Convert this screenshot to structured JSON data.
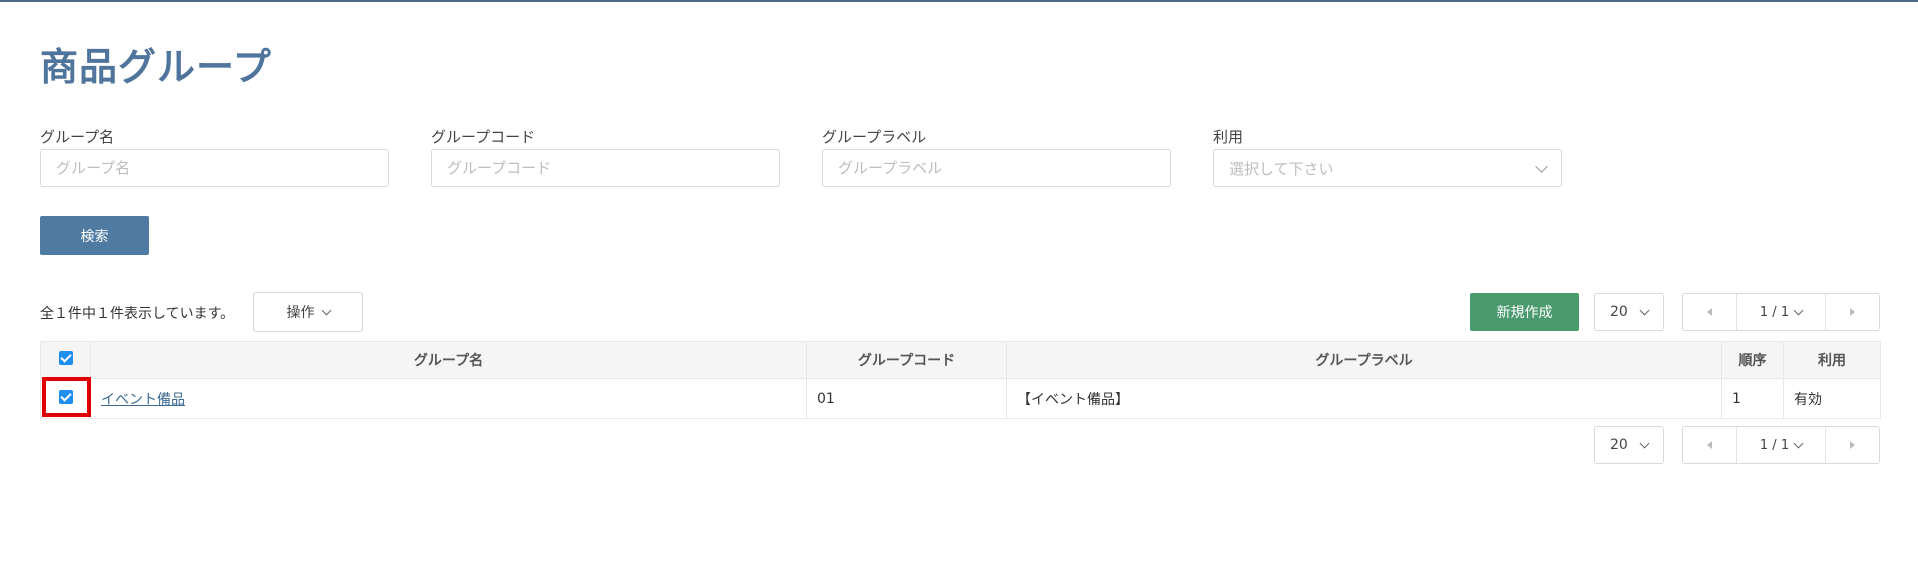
{
  "page": {
    "title": "商品グループ"
  },
  "filters": {
    "group_name": {
      "label": "グループ名",
      "placeholder": "グループ名"
    },
    "group_code": {
      "label": "グループコード",
      "placeholder": "グループコード"
    },
    "group_label": {
      "label": "グループラベル",
      "placeholder": "グループラベル"
    },
    "usage": {
      "label": "利用",
      "placeholder": "選択して下さい"
    }
  },
  "buttons": {
    "search": "検索",
    "operations": "操作",
    "new": "新規作成"
  },
  "summary": {
    "count_text": "全１件中１件表示しています。"
  },
  "pagination": {
    "page_size": "20",
    "page_indicator": "1 / 1"
  },
  "table": {
    "headers": {
      "group_name": "グループ名",
      "group_code": "グループコード",
      "group_label": "グループラベル",
      "order": "順序",
      "usage": "利用"
    },
    "rows": [
      {
        "group_name": "イベント備品",
        "group_code": "01",
        "group_label": "【イベント備品】",
        "order": "1",
        "usage": "有効",
        "checked": true
      }
    ]
  },
  "colors": {
    "title": "#50759d",
    "search_button": "#4f7aa1",
    "new_button": "#4a9a6e",
    "checkbox": "#1f8ef1",
    "highlight": "#e10000"
  }
}
